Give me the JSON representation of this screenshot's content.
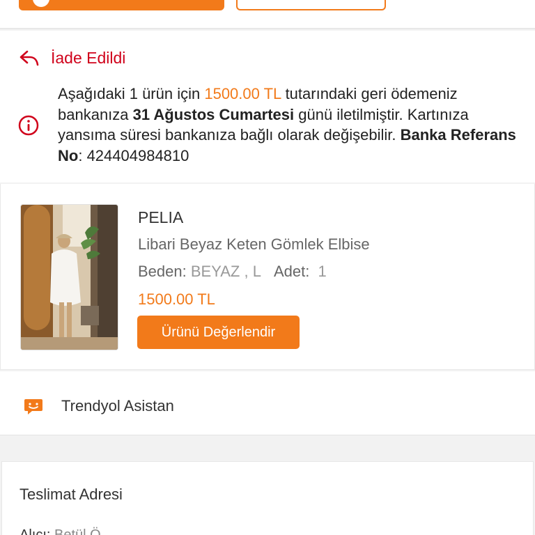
{
  "colors": {
    "accent": "#f27a1a",
    "refund_red": "#d0021b"
  },
  "refund": {
    "title": "İade Edildi",
    "icon": "reply-icon",
    "info_icon": "info-circle-icon",
    "text_1": "Aşağıdaki 1 ürün için ",
    "amount": "1500.00 TL",
    "text_2": " tutarındaki geri ödemeniz bankanıza ",
    "date": "31 Ağustos Cumartesi",
    "text_3": " günü iletilmiştir. Kartınıza yansıma süresi bankanıza bağlı olarak değişebilir. ",
    "ref_label": "Banka Referans No",
    "ref_sep": ": ",
    "ref_value": "424404984810"
  },
  "product": {
    "brand": "PELIA",
    "name": "Libari Beyaz Keten Gömlek Elbise",
    "size_label": "Beden:",
    "size_value": "BEYAZ , L",
    "qty_label": "Adet:",
    "qty_value": "1",
    "price": "1500.00 TL",
    "rate_button": "Ürünü Değerlendir"
  },
  "assistant": {
    "icon": "chat-bubble-icon",
    "label": "Trendyol Asistan"
  },
  "address": {
    "title": "Teslimat Adresi",
    "line_label": "Alıcı:",
    "line_value": "Betül Ö..."
  }
}
